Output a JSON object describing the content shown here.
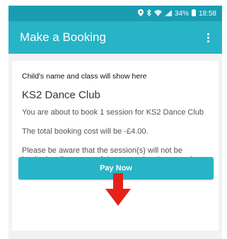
{
  "status_bar": {
    "battery": "34%",
    "time": "18:58",
    "icons": [
      "location-icon",
      "bluetooth-icon",
      "wifi-icon",
      "signal-icon",
      "battery-icon"
    ]
  },
  "app_bar": {
    "title": "Make a Booking",
    "menu_icon": "more-vert-icon"
  },
  "booking": {
    "child_line": "Child's name and class will show here",
    "club_name": "KS2 Dance Club",
    "session_text": "You are about to book 1 session for KS2 Dance Club",
    "cost_text": "The total booking cost will be -£4.00.",
    "notice_text": "Please be aware that the session(s) will not be booked until a successful payment has been made.",
    "pay_button": "Pay Now"
  },
  "colors": {
    "status_bar": "#1a9db1",
    "app_bar": "#27b4c6",
    "button": "#27b4c6",
    "arrow": "#e52118",
    "background": "#f2f2f2"
  }
}
